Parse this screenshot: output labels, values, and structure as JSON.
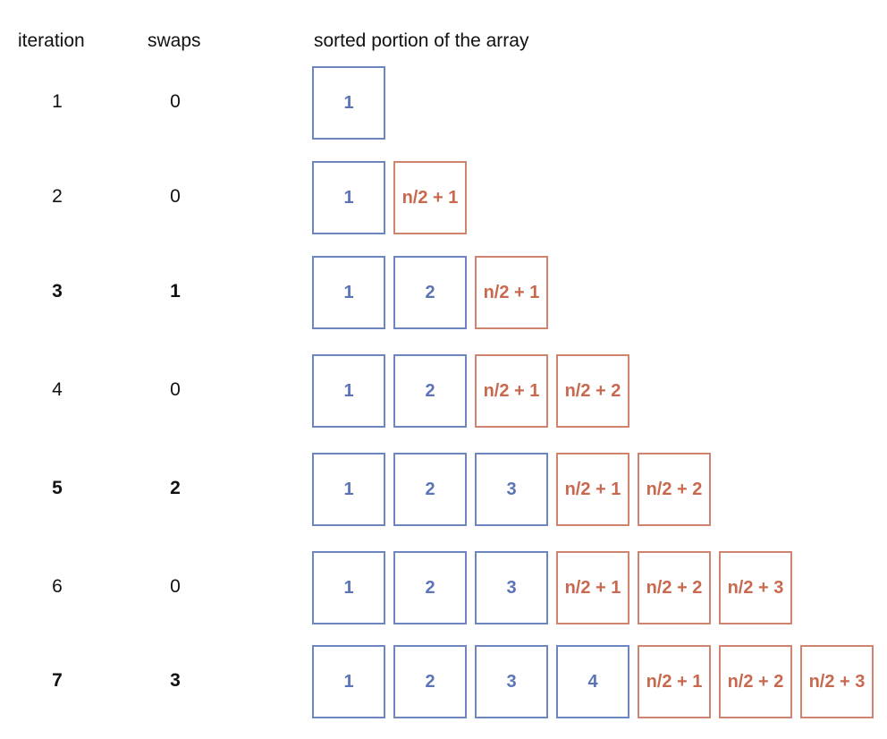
{
  "headers": {
    "iteration": "iteration",
    "swaps": "swaps",
    "sorted": "sorted portion of the array"
  },
  "colors": {
    "sorted_low": "#5b74b6",
    "sorted_high": "#c8694f"
  },
  "rows": [
    {
      "iteration": "1",
      "swaps": "0",
      "bold": false,
      "cells": [
        {
          "label": "1",
          "kind": "low"
        }
      ]
    },
    {
      "iteration": "2",
      "swaps": "0",
      "bold": false,
      "cells": [
        {
          "label": "1",
          "kind": "low"
        },
        {
          "label": "n/2 + 1",
          "kind": "high"
        }
      ]
    },
    {
      "iteration": "3",
      "swaps": "1",
      "bold": true,
      "cells": [
        {
          "label": "1",
          "kind": "low"
        },
        {
          "label": "2",
          "kind": "low"
        },
        {
          "label": "n/2 + 1",
          "kind": "high"
        }
      ]
    },
    {
      "iteration": "4",
      "swaps": "0",
      "bold": false,
      "cells": [
        {
          "label": "1",
          "kind": "low"
        },
        {
          "label": "2",
          "kind": "low"
        },
        {
          "label": "n/2 + 1",
          "kind": "high"
        },
        {
          "label": "n/2 + 2",
          "kind": "high"
        }
      ]
    },
    {
      "iteration": "5",
      "swaps": "2",
      "bold": true,
      "cells": [
        {
          "label": "1",
          "kind": "low"
        },
        {
          "label": "2",
          "kind": "low"
        },
        {
          "label": "3",
          "kind": "low"
        },
        {
          "label": "n/2 + 1",
          "kind": "high"
        },
        {
          "label": "n/2 + 2",
          "kind": "high"
        }
      ]
    },
    {
      "iteration": "6",
      "swaps": "0",
      "bold": false,
      "cells": [
        {
          "label": "1",
          "kind": "low"
        },
        {
          "label": "2",
          "kind": "low"
        },
        {
          "label": "3",
          "kind": "low"
        },
        {
          "label": "n/2 + 1",
          "kind": "high"
        },
        {
          "label": "n/2 + 2",
          "kind": "high"
        },
        {
          "label": "n/2 + 3",
          "kind": "high"
        }
      ]
    },
    {
      "iteration": "7",
      "swaps": "3",
      "bold": true,
      "cells": [
        {
          "label": "1",
          "kind": "low"
        },
        {
          "label": "2",
          "kind": "low"
        },
        {
          "label": "3",
          "kind": "low"
        },
        {
          "label": "4",
          "kind": "low"
        },
        {
          "label": "n/2 + 1",
          "kind": "high"
        },
        {
          "label": "n/2 + 2",
          "kind": "high"
        },
        {
          "label": "n/2 + 3",
          "kind": "high"
        }
      ]
    }
  ]
}
